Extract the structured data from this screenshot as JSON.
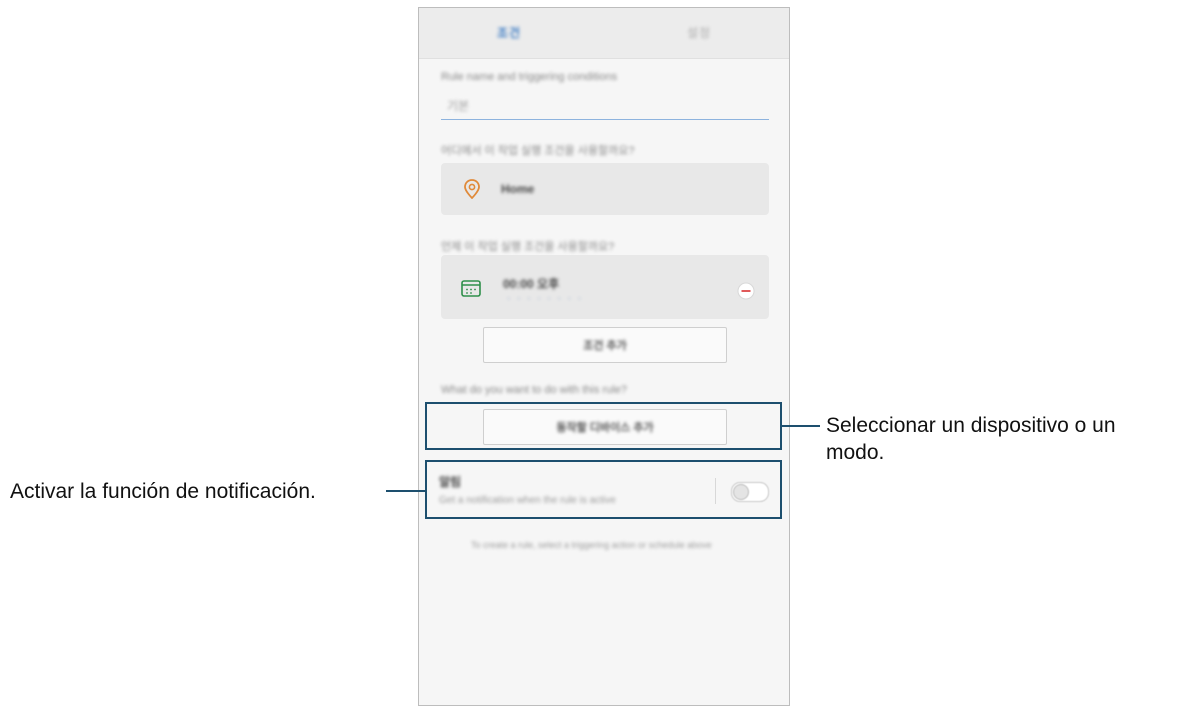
{
  "tabs": {
    "active": "조건",
    "other": "설정"
  },
  "rule": {
    "name_question": "Rule name and triggering conditions",
    "name_value": "기본",
    "location_question": "어디에서 이 작업 실행 조건을 사용할까요?",
    "location_value": "Home",
    "time_question": "언제 이 작업 실행 조건을 사용할까요?",
    "time_title": "00:00 오후",
    "time_sub": "· · · · · · · ·",
    "add_condition": "조건 추가",
    "action_question": "What do you want to do with this rule?",
    "add_device_mode": "동작할 디바이스 추가",
    "notify_title": "알림",
    "notify_sub": "Get a notification when the rule is active",
    "footer_note": "To create a rule, select a triggering action or schedule above"
  },
  "callouts": {
    "right": "Seleccionar un dispositivo o un modo.",
    "right_line1": "Seleccionar un dispositivo o un",
    "right_line2": "modo.",
    "left": "Activar la función de notificación."
  },
  "colors": {
    "callout": "#1d4f6e",
    "accent": "#3f7dc4",
    "location_icon": "#e08a3a",
    "calendar_icon": "#2f8f4a",
    "remove_icon": "#e05a5a"
  },
  "icons": {
    "location": "location-pin-icon",
    "calendar": "calendar-icon",
    "remove": "minus-circle-icon"
  },
  "notify_toggle": {
    "on": false
  }
}
